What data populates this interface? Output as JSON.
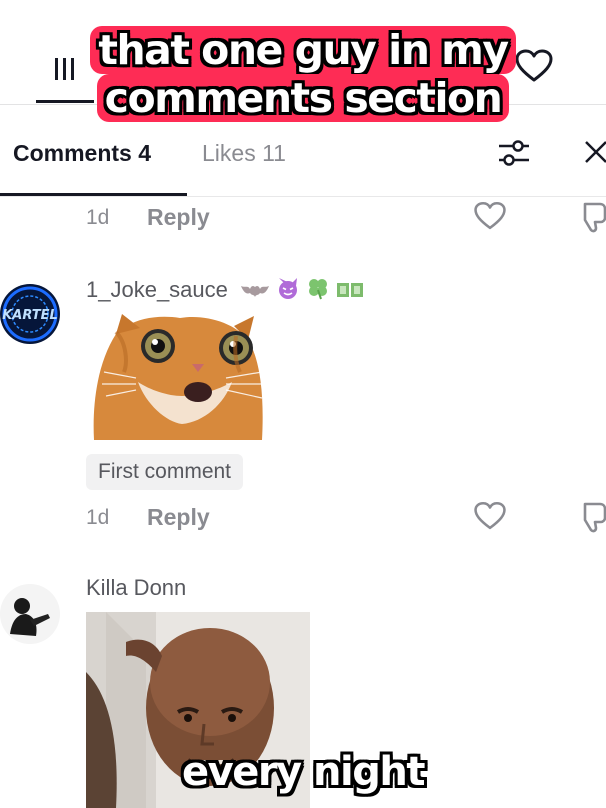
{
  "caption": {
    "line1": "that one guy in my",
    "line2": "comments section",
    "bottom": "every night",
    "accent": "#fe2c55"
  },
  "tabs": {
    "comments": "Comments 4",
    "likes": "Likes 11"
  },
  "icons": {
    "top": [
      "menu-icon",
      "message-icon",
      "bookmark-icon",
      "heart-icon"
    ],
    "tabs": [
      "filter-icon",
      "close-icon"
    ],
    "row": [
      "heart-icon",
      "dislike-icon"
    ]
  },
  "comments": [
    {
      "time": "1d",
      "reply_label": "Reply"
    },
    {
      "username": "1_Joke_sauce",
      "emoji_icons": [
        "bat-icon",
        "devil-icon",
        "clover-icon",
        "money-icon"
      ],
      "media": "cat-sticker",
      "chip": "First comment",
      "time": "1d",
      "reply_label": "Reply"
    },
    {
      "username": "Killa Donn",
      "media": "person-photo"
    }
  ],
  "avatar_text": "KARTEL"
}
